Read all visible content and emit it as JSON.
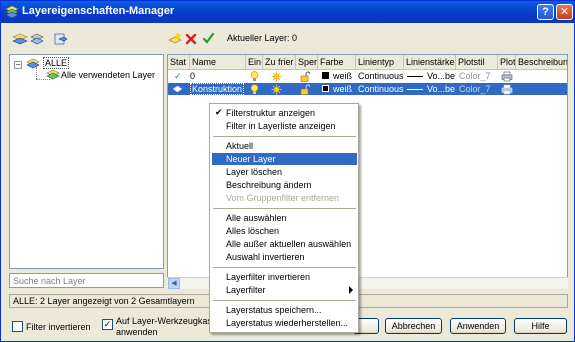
{
  "window": {
    "title": "Layereigenschaften-Manager"
  },
  "toolbar": {
    "current_layer_label": "Aktueller Layer: 0"
  },
  "tree": {
    "root": "ALLE",
    "child": "Alle verwendeten Layer"
  },
  "search": {
    "placeholder": "Suche nach Layer"
  },
  "columns": [
    "Stat",
    "Name",
    "Ein",
    "Zu frier",
    "Sper",
    "Farbe",
    "Linientyp",
    "Linienstärke",
    "Plotstil",
    "Plot",
    "Beschreibung"
  ],
  "layers": [
    {
      "name": "0",
      "color": "weiß",
      "linetype": "Continuous",
      "lineweight": "Vo...be",
      "plotstyle": "Color_7"
    },
    {
      "name": "Konstruktion",
      "color": "weiß",
      "linetype": "Continuous",
      "lineweight": "Vo...be",
      "plotstyle": "Color_7"
    }
  ],
  "status_bar": "ALLE: 2 Layer angezeigt von 2 Gesamtlayern",
  "options": {
    "invert_filter": "Filter invertieren",
    "apply_toolbar_line1": "Auf Layer-Werkzeugkaste",
    "apply_toolbar_line2": "anwenden"
  },
  "buttons": {
    "cancel": "Abbrechen",
    "apply": "Anwenden",
    "help": "Hilfe"
  },
  "context_menu": [
    "Filterstruktur anzeigen",
    "Filter in Layerliste anzeigen",
    "Aktuell",
    "Neuer Layer",
    "Layer löschen",
    "Beschreibung ändern",
    "Vom Gruppenfilter entfernen",
    "Alle auswählen",
    "Alles löschen",
    "Alle außer aktuellen auswählen",
    "Auswahl invertieren",
    "Layerfilter invertieren",
    "Layerfilter",
    "Layerstatus speichern...",
    "Layerstatus wiederherstellen..."
  ],
  "colors": {
    "selection": "#316ac5",
    "titlebar": "#0839c9",
    "dialog": "#ece9d8"
  }
}
